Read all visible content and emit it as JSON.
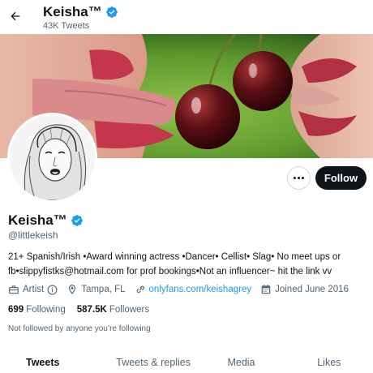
{
  "header": {
    "title": "Keisha™",
    "tweet_count": "43K Tweets"
  },
  "profile": {
    "name": "Keisha™",
    "handle": "@littlekeish",
    "bio": "21+ Spanish/Irish •Award winning actress •Dancer• Cellist• Slag• No meet ups or fb•slippyfistks@hotmail.com for prof bookings•Not an influencer~ hit the link vv",
    "category": "Artist",
    "location": "Tampa, FL",
    "website": "onlyfans.com/keishagrey",
    "joined": "Joined June 2016",
    "following_count": "699",
    "following_label": "Following",
    "followers_count": "587.5K",
    "followers_label": "Followers",
    "mutuals_text": "Not followed by anyone you’re following"
  },
  "actions": {
    "follow_label": "Follow"
  },
  "tabs": [
    {
      "label": "Tweets",
      "active": true
    },
    {
      "label": "Tweets & replies",
      "active": false
    },
    {
      "label": "Media",
      "active": false
    },
    {
      "label": "Likes",
      "active": false
    }
  ],
  "colors": {
    "accent": "#1d9bf0",
    "text_primary": "#0f1419",
    "text_secondary": "#536471",
    "follow_button": "#0f1419"
  },
  "icons": {
    "back": "arrow-left-icon",
    "verified": "verified-badge-icon",
    "more": "more-icon",
    "category": "briefcase-icon",
    "location": "location-pin-icon",
    "link": "link-icon",
    "joined": "calendar-icon",
    "info": "info-icon"
  }
}
